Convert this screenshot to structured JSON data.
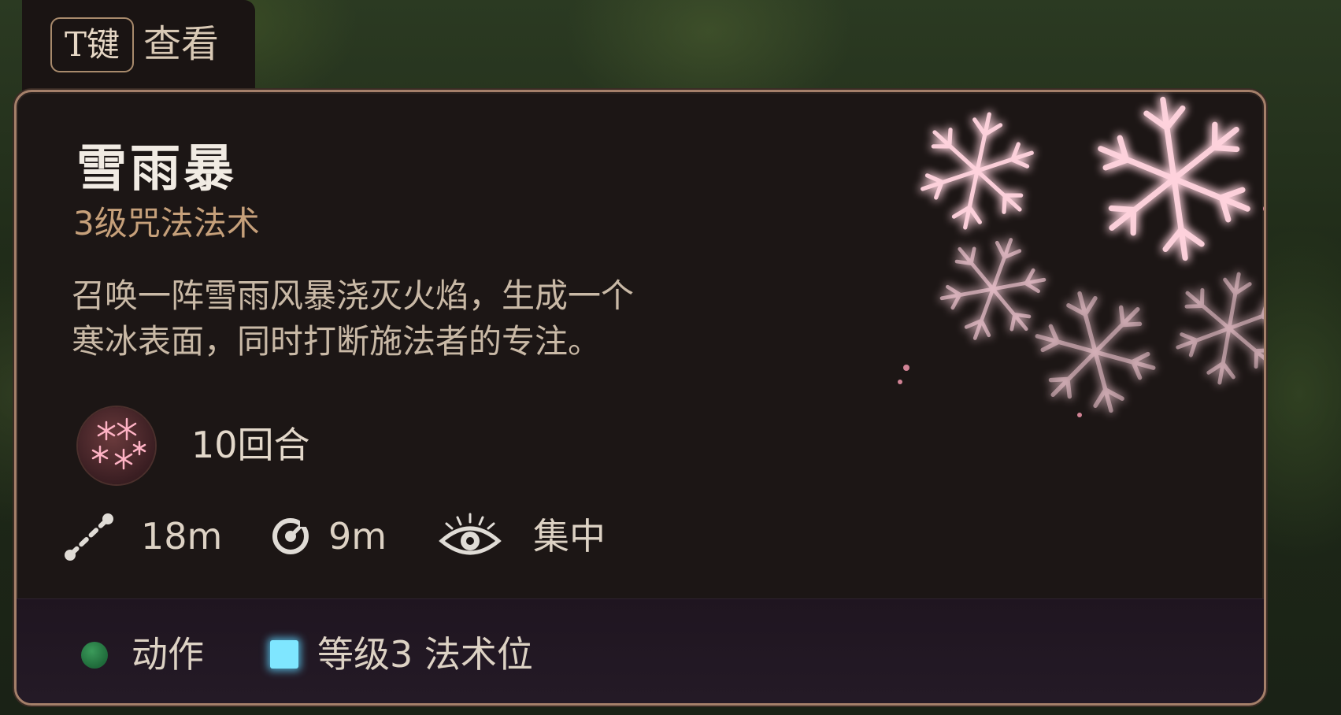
{
  "hotkey_hint": {
    "key": "T键",
    "label": "查看"
  },
  "spell": {
    "name": "雪雨暴",
    "subtitle": "3级咒法法术",
    "description_lines": [
      "召唤一阵雪雨风暴浇灭火焰，生成一个",
      "寒冰表面，同时打断施法者的专注。"
    ],
    "duration": "10回合",
    "stats": {
      "range": "18m",
      "radius": "9m",
      "concentration": "集中"
    },
    "cost": {
      "action": "动作",
      "slot": "等级3 法术位"
    }
  },
  "colors": {
    "card_bg": "#1c1615",
    "card_border": "#a5806a",
    "subtitle": "#c6a07a",
    "snowflake": "#ff8fa8",
    "action_dot": "#2e8a4e",
    "slot_square": "#7fe6ff"
  },
  "icons": {
    "range": "range-line-icon",
    "radius": "radius-target-icon",
    "concentration": "eye-icon",
    "spell_art": "snowflake-icon"
  }
}
